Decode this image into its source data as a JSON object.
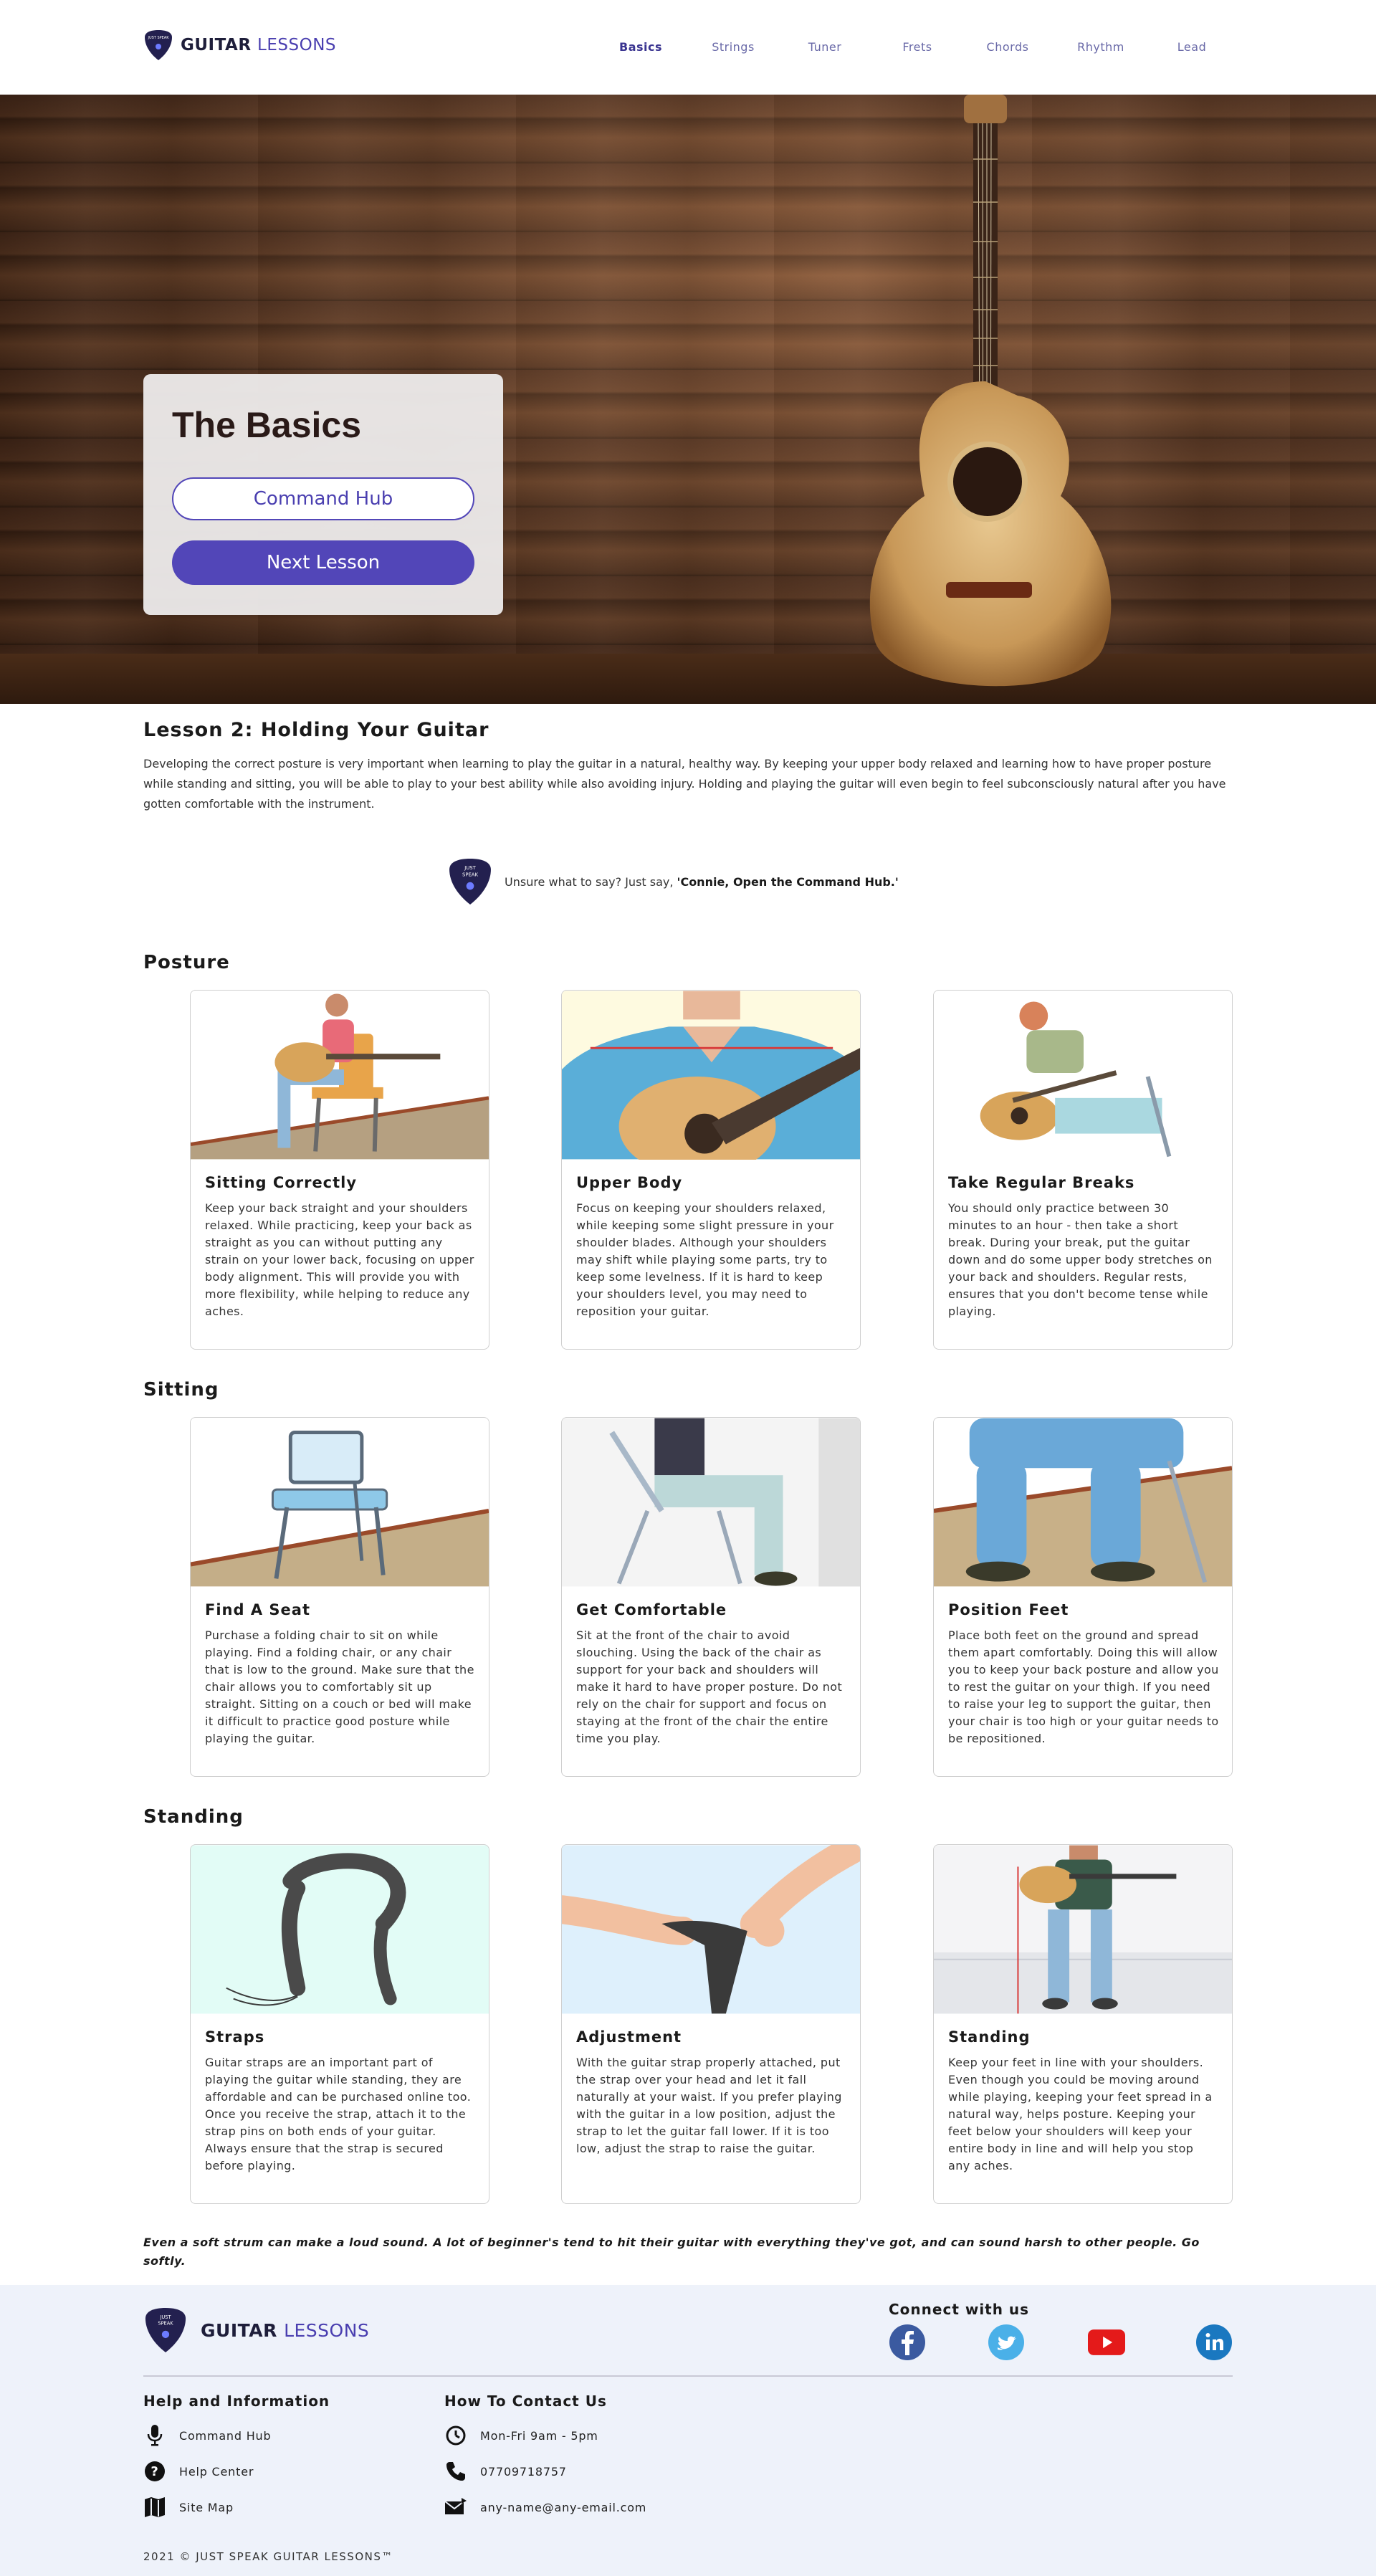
{
  "brand": {
    "name_part1": "GUITAR",
    "name_part2": "LESSONS",
    "badge_text": "JUST SPEAK"
  },
  "nav": [
    {
      "label": "Basics",
      "active": true
    },
    {
      "label": "Strings",
      "active": false
    },
    {
      "label": "Tuner",
      "active": false
    },
    {
      "label": "Frets",
      "active": false
    },
    {
      "label": "Chords",
      "active": false
    },
    {
      "label": "Rhythm",
      "active": false
    },
    {
      "label": "Lead",
      "active": false
    }
  ],
  "hero": {
    "title": "The Basics",
    "command_hub_label": "Command Hub",
    "next_lesson_label": "Next Lesson"
  },
  "lesson": {
    "title": "Lesson 2: Holding Your Guitar",
    "text": "Developing the correct posture is very important when learning to play the guitar in a natural, healthy way. By keeping your upper body relaxed and learning how to have proper posture while standing and sitting, you will be able to play to your best ability while also avoiding injury. Holding and playing the guitar will even begin to feel subconsciously natural after you have gotten comfortable with the instrument."
  },
  "hint": {
    "prefix": "Unsure what to say? Just say, ",
    "command": "'Connie, Open the Command Hub.'"
  },
  "sections": [
    {
      "title": "Posture",
      "cards": [
        {
          "title": "Sitting Correctly",
          "text": "Keep your back straight and your shoulders relaxed. While practicing, keep your back as straight as you can without putting any strain on your lower back, focusing on upper body alignment. This will provide you with more flexibility, while helping to reduce any aches."
        },
        {
          "title": "Upper Body",
          "text": "Focus on keeping your shoulders relaxed, while keeping some slight pressure in your shoulder blades. Although your shoulders may shift while playing some parts, try to keep some levelness. If it is hard to keep your shoulders level, you may need to reposition your guitar."
        },
        {
          "title": "Take Regular Breaks",
          "text": "You should only practice between 30 minutes to an hour - then take a short break. During your break, put the guitar down and do some upper body stretches on your back and shoulders. Regular rests, ensures that you don't become tense while playing."
        }
      ]
    },
    {
      "title": "Sitting",
      "cards": [
        {
          "title": "Find A Seat",
          "text": "Purchase a folding chair to sit on while playing. Find a folding chair, or any chair that is low to the ground. Make sure that the chair allows you to comfortably sit up straight. Sitting on a couch or bed will make it difficult to practice good posture while playing the guitar."
        },
        {
          "title": "Get Comfortable",
          "text": "Sit at the front of the chair to avoid slouching. Using the back of the chair as support for your back and shoulders will make it hard to have proper posture. Do not rely on the chair for support and focus on staying at the front of the chair the entire time you play."
        },
        {
          "title": "Position Feet",
          "text": "Place both feet on the ground and spread them apart comfortably. Doing this will allow you to keep your back posture and allow you to rest the guitar on your thigh. If you need to raise your leg to support the guitar, then your chair is too high or your guitar needs to be repositioned."
        }
      ]
    },
    {
      "title": "Standing",
      "cards": [
        {
          "title": "Straps",
          "text": "Guitar straps are an important part of playing the guitar while standing, they are affordable and can be purchased online too. Once you receive the strap, attach it to the strap pins on both ends of your guitar. Always ensure that the strap is secured before playing."
        },
        {
          "title": "Adjustment",
          "text": "With the guitar strap properly attached, put the strap over your head and let it fall naturally at your waist. If you prefer playing with the guitar in a low position, adjust the strap to let the guitar fall lower. If it is too low, adjust the strap to raise the guitar."
        },
        {
          "title": "Standing",
          "text": "Keep your feet in line with your shoulders. Even though you could be moving around while playing, keeping your feet spread in a natural way, helps posture. Keeping your feet below your shoulders will keep your entire body in line and will help you stop any aches."
        }
      ]
    }
  ],
  "quote": "Even a soft strum can make a loud sound. A lot of beginner's tend to hit their guitar with everything they've got, and can sound harsh to other people. Go softly.",
  "footer": {
    "connect_title": "Connect with us",
    "socials": [
      "facebook-icon",
      "twitter-icon",
      "youtube-icon",
      "linkedin-icon"
    ],
    "help_title": "Help and Information",
    "help_items": [
      "Command Hub",
      "Help Center",
      "Site Map"
    ],
    "contact_title": "How To Contact Us",
    "contact_items": [
      "Mon-Fri 9am - 5pm",
      "07709718757",
      "any-name@any-email.com"
    ],
    "copyright": "2021 © JUST SPEAK GUITAR LESSONS™"
  },
  "colors": {
    "accent": "#5246b8",
    "brand_dark": "#1e1e3a",
    "footer_bg": "#eef2fa"
  }
}
